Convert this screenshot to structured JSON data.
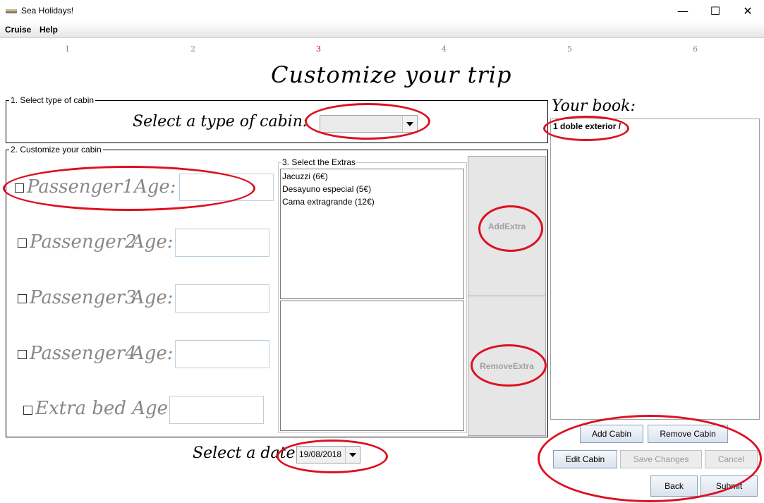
{
  "window": {
    "title": "Sea Holidays!",
    "minimize": "—",
    "maximize": "☐",
    "close": "✕"
  },
  "menu": {
    "cruise": "Cruise",
    "help": "Help"
  },
  "steps": [
    "1",
    "2",
    "3",
    "4",
    "5",
    "6"
  ],
  "active_step": "3",
  "page_title": "Customize your trip",
  "cabin_type": {
    "legend": "1. Select type of cabin",
    "label": "Select a type of cabin:",
    "selected": ""
  },
  "customize": {
    "legend": "2. Customize your cabin",
    "passengers": [
      {
        "label": "Passenger1",
        "age_label": "Age:",
        "value": ""
      },
      {
        "label": "Passenger2",
        "age_label": "Age:",
        "value": ""
      },
      {
        "label": "Passenger3",
        "age_label": "Age:",
        "value": ""
      },
      {
        "label": "Passenger4",
        "age_label": "Age:",
        "value": ""
      }
    ],
    "extra_bed": {
      "label": "Extra bed Age:",
      "value": ""
    }
  },
  "extras": {
    "legend": "3. Select the Extras",
    "available": [
      "Jacuzzi (6€)",
      "Desayuno especial (5€)",
      "Cama extragrande (12€)"
    ],
    "selected": [],
    "add_label": "AddExtra",
    "remove_label": "RemoveExtra"
  },
  "date": {
    "label": "Select a date",
    "value": "19/08/2018"
  },
  "book": {
    "title": "Your book:",
    "items": [
      "1 doble exterior /"
    ]
  },
  "buttons": {
    "add_cabin": "Add Cabin",
    "remove_cabin": "Remove Cabin",
    "edit_cabin": "Edit Cabin",
    "save_changes": "Save Changes",
    "cancel": "Cancel",
    "back": "Back",
    "submit": "Submit"
  },
  "colors": {
    "accent_red": "#dd1020",
    "disabled_text": "#a0a0a0"
  }
}
